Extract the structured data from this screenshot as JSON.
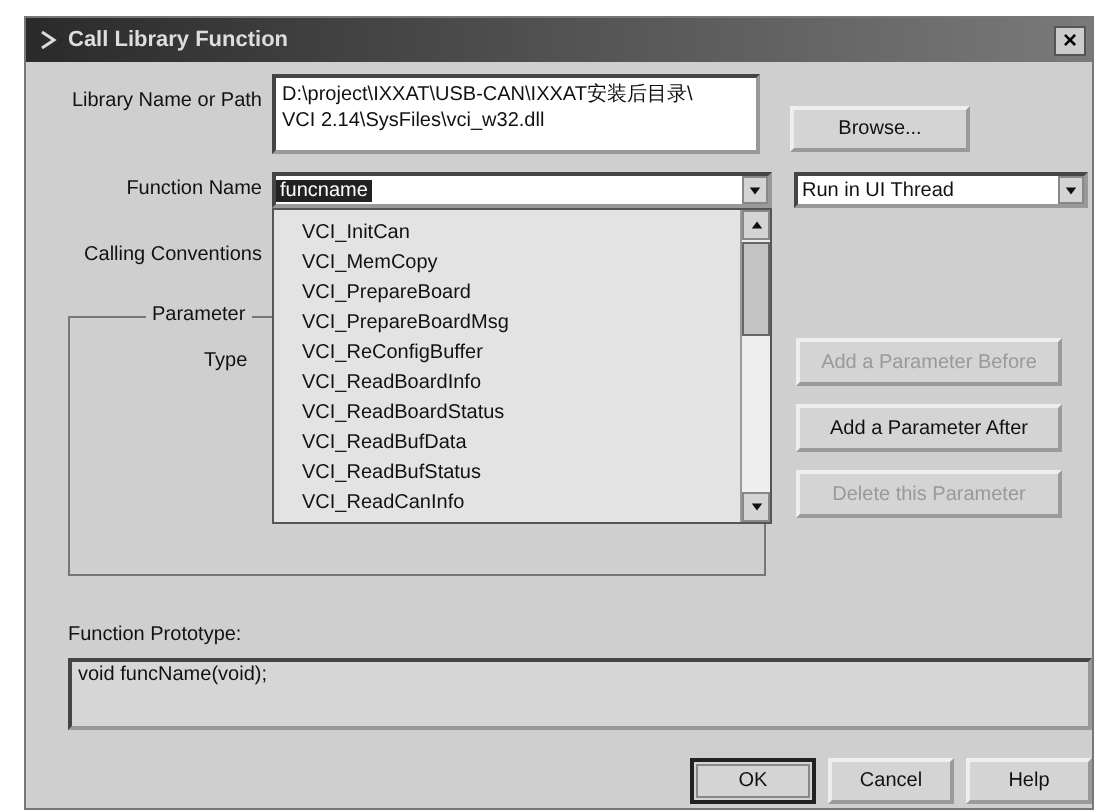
{
  "window": {
    "title": "Call Library Function",
    "close": "×"
  },
  "library": {
    "label": "Library Name or Path",
    "path_lines": [
      "D:\\project\\IXXAT\\USB-CAN\\IXXAT安装后目录\\",
      "VCI 2.14\\SysFiles\\vci_w32.dll"
    ],
    "browse": "Browse..."
  },
  "function_name": {
    "label": "Function Name",
    "value": "funcname",
    "highlighted": true
  },
  "thread": {
    "value": "Run in UI Thread"
  },
  "calling_conventions": {
    "label": "Calling Conventions"
  },
  "dropdown": {
    "items": [
      {
        "label": "VCI_InitCan",
        "selected": false
      },
      {
        "label": "VCI_MemCopy",
        "selected": false
      },
      {
        "label": "VCI_PrepareBoard",
        "selected": false
      },
      {
        "label": "VCI_PrepareBoardMsg",
        "selected": false
      },
      {
        "label": "VCI_ReConfigBuffer",
        "selected": false
      },
      {
        "label": "VCI_ReadBoardInfo",
        "selected": false
      },
      {
        "label": "VCI_ReadBoardStatus",
        "selected": false
      },
      {
        "label": "VCI_ReadBufData",
        "selected": false
      },
      {
        "label": "VCI_ReadBufStatus",
        "selected": false
      },
      {
        "label": "VCI_ReadCanInfo",
        "selected": false
      }
    ]
  },
  "parameter": {
    "title": "Parameter",
    "type_label": "Type"
  },
  "parameter_buttons": [
    {
      "label": "Add a Parameter Before",
      "disabled": true
    },
    {
      "label": "Add a Parameter After",
      "disabled": false
    },
    {
      "label": "Delete this Parameter",
      "disabled": true
    }
  ],
  "prototype": {
    "label": "Function Prototype:",
    "value": "void funcName(void);"
  },
  "dialog_buttons": [
    {
      "label": "OK",
      "default": true
    },
    {
      "label": "Cancel",
      "default": false
    },
    {
      "label": "Help",
      "default": false
    }
  ]
}
